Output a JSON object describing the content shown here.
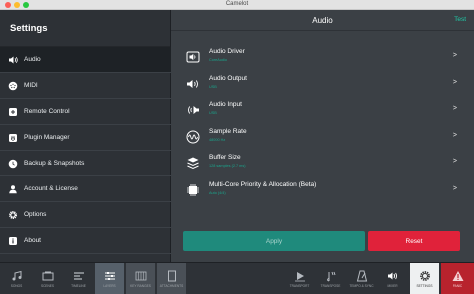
{
  "window": {
    "title": "Camelot"
  },
  "sidebar": {
    "title": "Settings",
    "items": [
      {
        "label": "Audio",
        "icon": "speaker-icon",
        "active": true
      },
      {
        "label": "MIDI",
        "icon": "midi-icon"
      },
      {
        "label": "Remote Control",
        "icon": "remote-icon"
      },
      {
        "label": "Plugin Manager",
        "icon": "plug-icon"
      },
      {
        "label": "Backup & Snapshots",
        "icon": "backup-icon"
      },
      {
        "label": "Account & License",
        "icon": "user-icon"
      },
      {
        "label": "Options",
        "icon": "gear-icon"
      },
      {
        "label": "About",
        "icon": "info-icon"
      }
    ]
  },
  "main": {
    "title": "Audio",
    "test_label": "Test",
    "rows": [
      {
        "label": "Audio Driver",
        "value": "CoreAudio"
      },
      {
        "label": "Audio Output",
        "value": "USB"
      },
      {
        "label": "Audio Input",
        "value": "USB"
      },
      {
        "label": "Sample Rate",
        "value": "48000 Hz"
      },
      {
        "label": "Buffer Size",
        "value": "128 samples (2.7 ms)"
      },
      {
        "label": "Multi-Core Priority & Allocation (Beta)",
        "value": "Auto (4/4)"
      }
    ],
    "chevron": ">",
    "apply_label": "Apply",
    "reset_label": "Reset"
  },
  "toolbar": {
    "items": [
      {
        "label": "SONGS",
        "icon": "music-icon"
      },
      {
        "label": "SCENES",
        "icon": "scenes-icon"
      },
      {
        "label": "TIMELINE",
        "icon": "timeline-icon"
      },
      {
        "label": "LAYERS",
        "icon": "layers-icon",
        "state": "selected"
      },
      {
        "label": "KEY RANGES",
        "icon": "key-ranges-icon",
        "state": "selected-dim"
      },
      {
        "label": "ATTACHMENTS",
        "icon": "attachments-icon",
        "state": "selected-dim"
      },
      {
        "label": "TRANSPORT",
        "icon": "transport-icon"
      },
      {
        "label": "TRANSPOSE",
        "icon": "transpose-icon"
      },
      {
        "label": "TEMPO & SYNC",
        "icon": "metronome-icon"
      },
      {
        "label": "MIXER",
        "icon": "mixer-speaker-icon"
      },
      {
        "label": "SETTINGS",
        "icon": "settings-gear-icon",
        "state": "active"
      },
      {
        "label": "PANIC",
        "icon": "panic-icon",
        "state": "danger"
      }
    ]
  },
  "colors": {
    "accent": "#1fc9a6",
    "apply": "#1f8a7c",
    "reset": "#e0223a",
    "sidebar": "#2d3136",
    "main": "#3b4045"
  }
}
